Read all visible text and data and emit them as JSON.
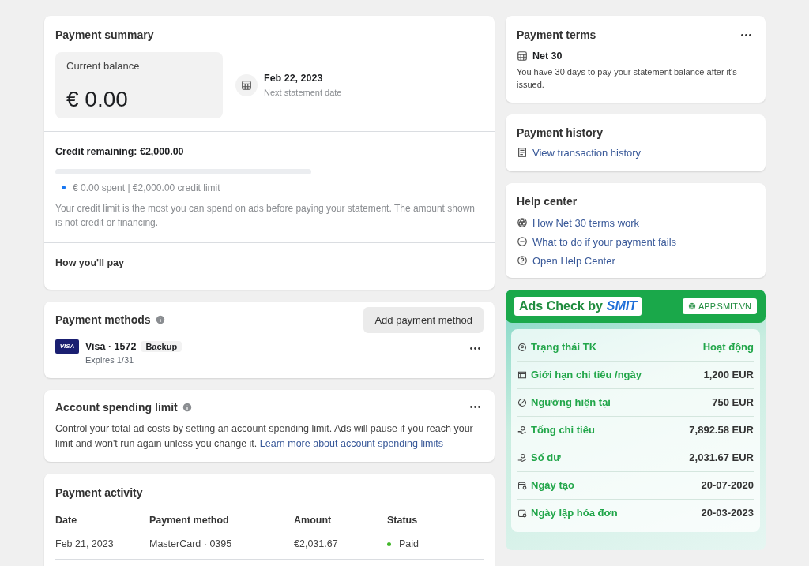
{
  "payment_summary": {
    "title": "Payment summary",
    "balance_label": "Current balance",
    "balance": "€ 0.00",
    "statement_date": "Feb 22, 2023",
    "statement_label": "Next statement date",
    "credit_remaining": "Credit remaining: €2,000.00",
    "credit": {
      "level": 0,
      "legend": "€ 0.00 spent | €2,000.00 credit limit"
    },
    "note": "Your credit limit is the most you can spend on ads before paying your statement. The amount shown is not credit or financing.",
    "how_pay": "How you'll pay"
  },
  "payment_methods": {
    "title": "Payment methods",
    "add_button": "Add payment method",
    "cards": [
      {
        "brand": "VISA",
        "name": "Visa · 1572",
        "tag": "Backup",
        "expires": "Expires 1/31"
      }
    ]
  },
  "spending_limit": {
    "title": "Account spending limit",
    "text": "Control your total ad costs by setting an account spending limit. Ads will pause if you reach your limit and won't run again unless you change it.",
    "link": "Learn more about account spending limits"
  },
  "payment_activity": {
    "title": "Payment activity",
    "columns": [
      "Date",
      "Payment method",
      "Amount",
      "Status"
    ],
    "rows": [
      {
        "date": "Feb 21, 2023",
        "method": "MasterCard · 0395",
        "amount": "€2,031.67",
        "status": "Paid",
        "color": "#42b72a"
      }
    ]
  },
  "payment_terms": {
    "title": "Payment terms",
    "name": "Net 30",
    "text": "You have 30 days to pay your statement balance after it's issued."
  },
  "payment_history": {
    "title": "Payment history",
    "link": "View transaction history"
  },
  "help_center": {
    "title": "Help center",
    "links": [
      {
        "kind": "network",
        "label": "How Net 30 terms work"
      },
      {
        "kind": "minus",
        "label": "What to do if your payment fails"
      },
      {
        "kind": "question",
        "label": "Open Help Center"
      }
    ]
  },
  "ads_check": {
    "title": "Ads Check by",
    "brand": "SMIT",
    "site": "APP.SMIT.VN",
    "rows": [
      {
        "kind": "status",
        "label": "Trạng thái TK",
        "value": "Hoạt động",
        "highlight": true
      },
      {
        "kind": "limit",
        "label": "Giới hạn chi tiêu /ngày",
        "value": "1,200 EUR",
        "highlight": false
      },
      {
        "kind": "threshold",
        "label": "Ngưỡng hiện tại",
        "value": "750 EUR",
        "highlight": false
      },
      {
        "kind": "money",
        "label": "Tổng chi tiêu",
        "value": "7,892.58 EUR",
        "highlight": false
      },
      {
        "kind": "money",
        "label": "Số dư",
        "value": "2,031.67 EUR",
        "highlight": false
      },
      {
        "kind": "date",
        "label": "Ngày tạo",
        "value": "20-07-2020",
        "highlight": false
      },
      {
        "kind": "date",
        "label": "Ngày lập hóa đơn",
        "value": "20-03-2023",
        "highlight": false
      }
    ]
  }
}
